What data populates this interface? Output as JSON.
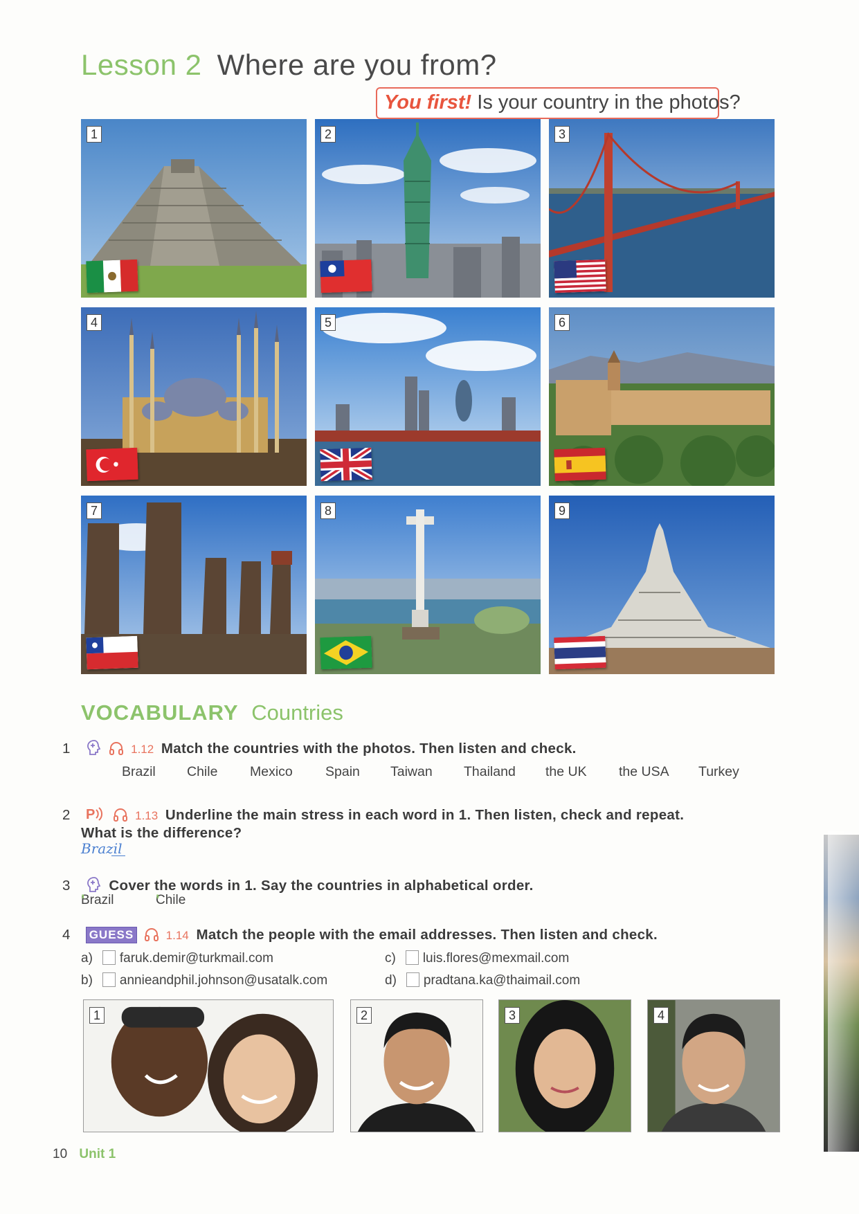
{
  "header": {
    "lesson_label": "Lesson 2",
    "lesson_question": "Where are you from?",
    "you_first_label": "You first!",
    "you_first_text": "Is your country in the photos?"
  },
  "photos": [
    {
      "number": "1",
      "scene": "pyramid",
      "flag": "mexico"
    },
    {
      "number": "2",
      "scene": "tower",
      "flag": "taiwan"
    },
    {
      "number": "3",
      "scene": "bridge",
      "flag": "usa"
    },
    {
      "number": "4",
      "scene": "mosque",
      "flag": "turkey"
    },
    {
      "number": "5",
      "scene": "city-river",
      "flag": "uk"
    },
    {
      "number": "6",
      "scene": "palace",
      "flag": "spain"
    },
    {
      "number": "7",
      "scene": "statues",
      "flag": "chile"
    },
    {
      "number": "8",
      "scene": "christ-statue",
      "flag": "brazil"
    },
    {
      "number": "9",
      "scene": "temple",
      "flag": "thailand"
    }
  ],
  "vocabulary": {
    "heading": "VOCABULARY",
    "subheading": "Countries"
  },
  "exercises": [
    {
      "number": "1",
      "track": "1.12",
      "text": "Match the countries with the photos. Then listen and check."
    },
    {
      "number": "2",
      "track": "1.13",
      "text": "Underline the main stress in each word in 1. Then listen, check and repeat.",
      "text_line2": "What is the difference?"
    },
    {
      "number": "3",
      "text": "Cover the words in 1. Say the countries in alphabetical order."
    },
    {
      "number": "4",
      "badge": "GUESS",
      "track": "1.14",
      "text": "Match the people with the email addresses. Then listen and check."
    }
  ],
  "countries": [
    "Brazil",
    "Chile",
    "Mexico",
    "Spain",
    "Taiwan",
    "Thailand",
    "the UK",
    "the USA",
    "Turkey"
  ],
  "example_answer": "Brazil",
  "alphabet_examples": [
    "Brazil",
    "Chile"
  ],
  "emails": [
    {
      "letter": "a)",
      "address": "faruk.demir@turkmail.com"
    },
    {
      "letter": "b)",
      "address": "annieandphil.johnson@usatalk.com"
    },
    {
      "letter": "c)",
      "address": "luis.flores@mexmail.com"
    },
    {
      "letter": "d)",
      "address": "pradtana.ka@thaimail.com"
    }
  ],
  "people_photos": [
    "1",
    "2",
    "3",
    "4"
  ],
  "footer": {
    "page_number": "10",
    "unit_label": "Unit 1"
  },
  "colors": {
    "accent_green": "#8cc36b",
    "accent_red": "#e8553e",
    "guess_purple": "#8a78c8"
  }
}
